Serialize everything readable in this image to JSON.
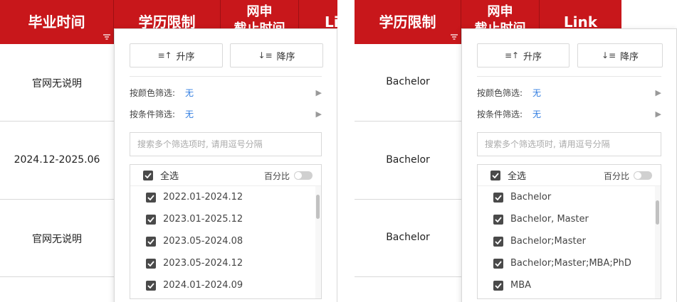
{
  "left": {
    "headers": [
      "毕业时间",
      "学历限制",
      "网申",
      "截止时间",
      "Li"
    ],
    "rows": [
      "官网无说明",
      "2024.12-2025.06",
      "官网无说明"
    ],
    "dropdown": {
      "sort_asc": "升序",
      "sort_desc": "降序",
      "color_filter_label": "按颜色筛选:",
      "color_filter_value": "无",
      "cond_filter_label": "按条件筛选:",
      "cond_filter_value": "无",
      "search_placeholder": "搜索多个筛选项时, 请用逗号分隔",
      "select_all": "全选",
      "percent": "百分比",
      "items": [
        "2022.01-2024.12",
        "2023.01-2025.12",
        "2023.05-2024.08",
        "2023.05-2024.12",
        "2024.01-2024.09"
      ]
    }
  },
  "right": {
    "headers": [
      "学历限制",
      "网申",
      "截止时间",
      "Link"
    ],
    "rows": [
      "Bachelor",
      "Bachelor",
      "Bachelor"
    ],
    "dropdown": {
      "sort_asc": "升序",
      "sort_desc": "降序",
      "color_filter_label": "按颜色筛选:",
      "color_filter_value": "无",
      "cond_filter_label": "按条件筛选:",
      "cond_filter_value": "无",
      "search_placeholder": "搜索多个筛选项时, 请用逗号分隔",
      "select_all": "全选",
      "percent": "百分比",
      "items": [
        "Bachelor",
        "Bachelor, Master",
        "Bachelor;Master",
        "Bachelor;Master;MBA;PhD",
        "MBA"
      ]
    }
  },
  "colors": {
    "header_bg": "#c8171b",
    "link_blue": "#2f7ce0",
    "checkbox": "#4a4a4a"
  }
}
